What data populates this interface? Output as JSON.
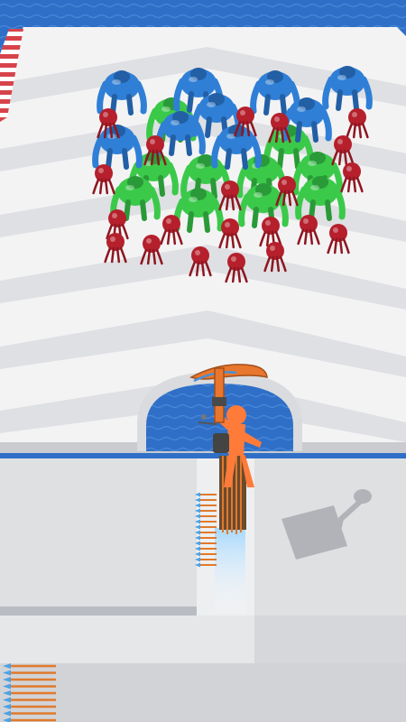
{
  "scene": {
    "colors": {
      "water": "#2f6fc7",
      "water_highlight": "#4f92e0",
      "track": "#f3f3f4",
      "track_stripe": "#dcdde0",
      "rail_red": "#d7434a",
      "platform": "#dfe0e2",
      "platform_side": "#b9bcc2",
      "player": "#ff7b3a",
      "crossbow": "#e8762e",
      "crossbow_blue": "#4a90d6"
    },
    "enemies": [
      {
        "type": "blue-brute"
      },
      {
        "type": "blue-brute"
      },
      {
        "type": "blue-brute"
      },
      {
        "type": "blue-brute"
      },
      {
        "type": "blue-brute"
      },
      {
        "type": "blue-brute"
      },
      {
        "type": "blue-brute"
      },
      {
        "type": "blue-brute"
      },
      {
        "type": "blue-brute"
      },
      {
        "type": "green-brute"
      },
      {
        "type": "green-brute"
      },
      {
        "type": "green-brute"
      },
      {
        "type": "green-brute"
      },
      {
        "type": "green-brute"
      },
      {
        "type": "green-brute"
      },
      {
        "type": "green-brute"
      },
      {
        "type": "green-brute"
      },
      {
        "type": "green-brute"
      },
      {
        "type": "green-brute"
      },
      {
        "type": "red-minion"
      }
    ],
    "player": {
      "role": "archer",
      "weapon": "crossbow"
    },
    "arrow_pickups": {
      "icon": "arrow-icon"
    }
  }
}
